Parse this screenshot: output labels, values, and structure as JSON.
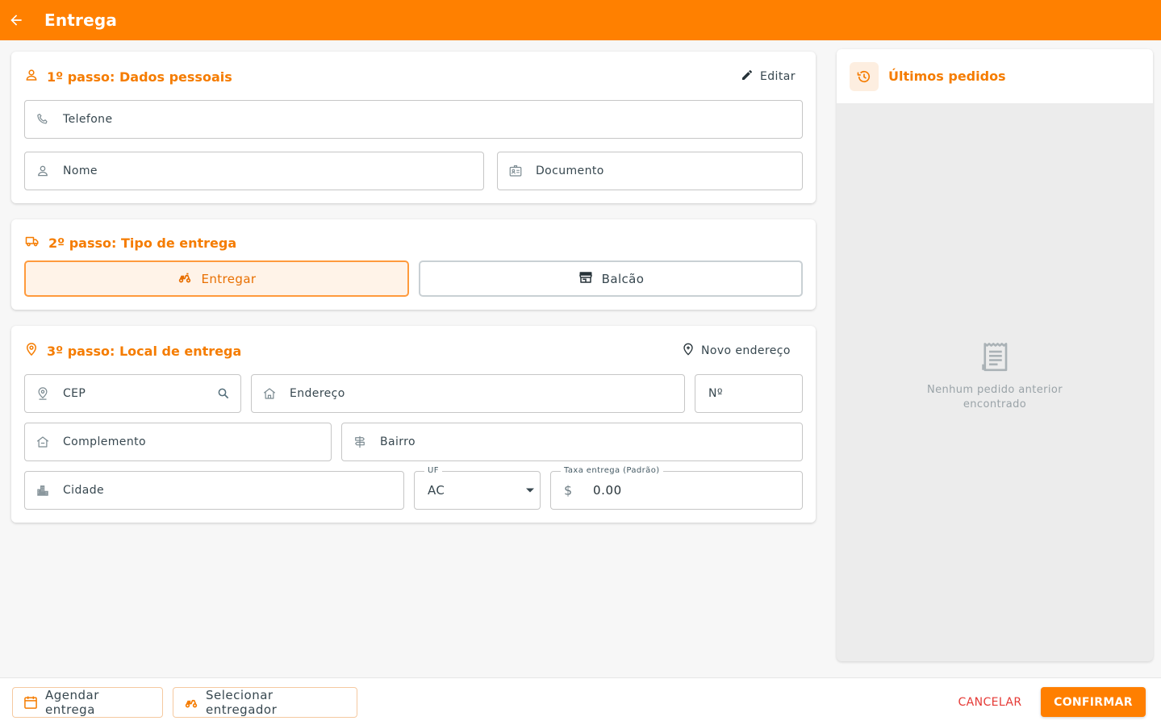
{
  "header": {
    "title": "Entrega",
    "back_icon": "arrow-left-icon"
  },
  "colors": {
    "accent": "#ff8000",
    "title_orange": "#f57c00",
    "cancel_red": "#e53935"
  },
  "step1": {
    "title": "1º passo: Dados pessoais",
    "edit_label": "Editar",
    "phone_label": "Telefone",
    "name_label": "Nome",
    "document_label": "Documento"
  },
  "step2": {
    "title": "2º passo: Tipo de entrega",
    "deliver_label": "Entregar",
    "counter_label": "Balcão",
    "selected": "Entregar"
  },
  "step3": {
    "title": "3º passo: Local de entrega",
    "new_address_label": "Novo endereço",
    "cep_label": "CEP",
    "address_label": "Endereço",
    "number_label": "Nº",
    "complement_label": "Complemento",
    "district_label": "Bairro",
    "city_label": "Cidade",
    "uf_label": "UF",
    "uf_value": "AC",
    "fee_label": "Taxa entrega (Padrão)",
    "fee_currency": "$",
    "fee_value": "0.00"
  },
  "sidebar": {
    "title": "Últimos pedidos",
    "empty_message": "Nenhum pedido anterior encontrado"
  },
  "footer": {
    "schedule_label": "Agendar entrega",
    "select_courier_label": "Selecionar entregador",
    "cancel_label": "CANCELAR",
    "confirm_label": "CONFIRMAR"
  }
}
